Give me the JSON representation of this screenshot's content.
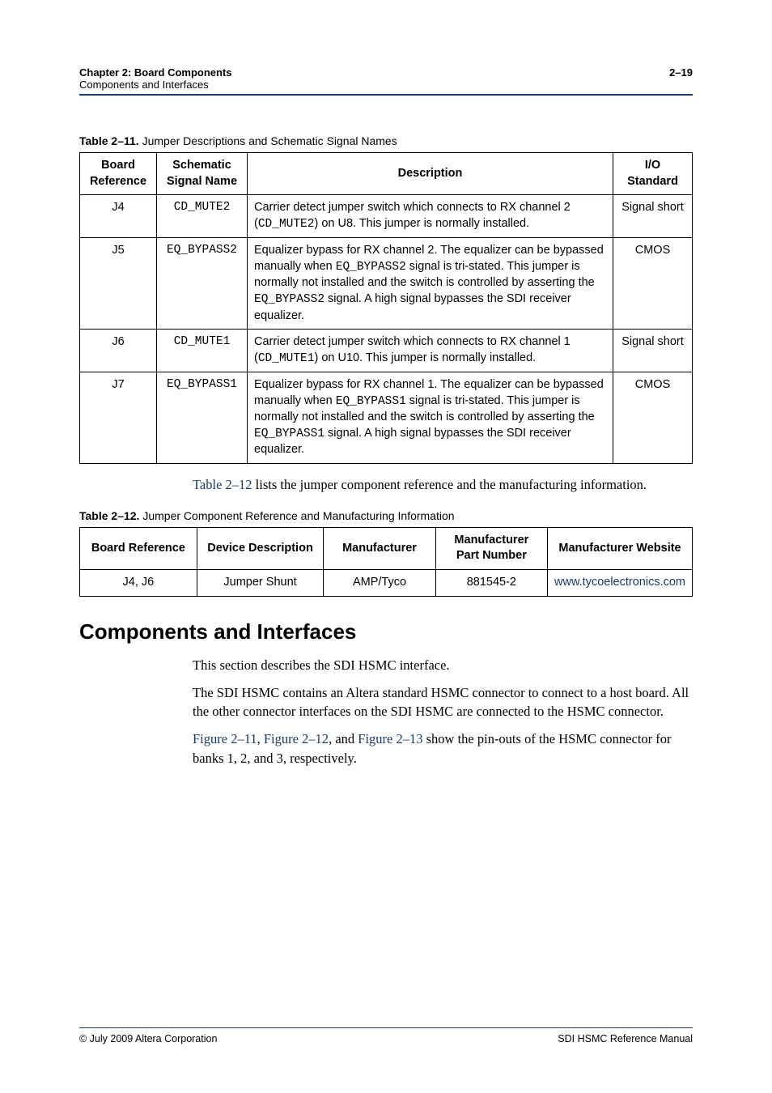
{
  "header": {
    "chapter": "Chapter 2: Board Components",
    "section": "Components and Interfaces",
    "page_num": "2–19"
  },
  "table1": {
    "num": "Table 2–11.",
    "title": "Jumper Descriptions and Schematic Signal Names",
    "headers": {
      "c1": "Board Reference",
      "c2": "Schematic Signal Name",
      "c3": "Description",
      "c4": "I/O Standard"
    },
    "rows": [
      {
        "ref": "J4",
        "signal": "CD_MUTE2",
        "desc_pre": "Carrier detect jumper switch which connects to RX channel 2 (",
        "desc_mono": "CD_MUTE2",
        "desc_post": ") on U8. This jumper is normally installed.",
        "io": "Signal short"
      },
      {
        "ref": "J5",
        "signal": "EQ_BYPASS2",
        "desc_pre": "Equalizer bypass for RX channel 2. The equalizer can be bypassed manually when ",
        "desc_mono": "EQ_BYPASS2",
        "desc_mid": " signal is tri-stated. This jumper is normally not installed and the switch is controlled by asserting the ",
        "desc_mono2": "EQ_BYPASS2",
        "desc_post2": " signal. A high signal bypasses the SDI receiver equalizer.",
        "io": "CMOS"
      },
      {
        "ref": "J6",
        "signal": "CD_MUTE1",
        "desc_pre": "Carrier detect jumper switch which connects to RX channel 1 (",
        "desc_mono": "CD_MUTE1",
        "desc_post": ") on U10. This jumper is normally installed.",
        "io": "Signal short"
      },
      {
        "ref": "J7",
        "signal": "EQ_BYPASS1",
        "desc_pre": "Equalizer bypass for RX channel 1. The equalizer can be bypassed manually when ",
        "desc_mono": "EQ_BYPASS1",
        "desc_mid": " signal is tri-stated. This jumper is normally not installed and the switch is controlled by asserting the ",
        "desc_mono2": "EQ_BYPASS1",
        "desc_post2": " signal. A high signal bypasses the SDI receiver equalizer.",
        "io": "CMOS"
      }
    ]
  },
  "para1": {
    "xref": "Table 2–12",
    "text": " lists the jumper component reference and the manufacturing information."
  },
  "table2": {
    "num": "Table 2–12.",
    "title": "Jumper Component Reference and Manufacturing Information",
    "headers": {
      "c1": "Board Reference",
      "c2": "Device Description",
      "c3": "Manufacturer",
      "c4": "Manufacturer Part Number",
      "c5": "Manufacturer Website"
    },
    "row": {
      "ref": "J4, J6",
      "desc": "Jumper Shunt",
      "mfr": "AMP/Tyco",
      "part": "881545-2",
      "url": "www.tycoelectronics.com"
    }
  },
  "section": {
    "heading": "Components and Interfaces",
    "p1": "This section describes the SDI HSMC interface.",
    "p2": "The SDI HSMC contains an Altera standard HSMC connector to connect to a host board. All the other connector interfaces on the SDI HSMC are connected to the HSMC connector.",
    "p3_x1": "Figure 2–11",
    "p3_s1": ", ",
    "p3_x2": "Figure 2–12",
    "p3_s2": ", and ",
    "p3_x3": "Figure 2–13",
    "p3_rest": " show the pin-outs of the HSMC connector for banks 1, 2, and 3, respectively."
  },
  "footer": {
    "left": "© July 2009   Altera Corporation",
    "right": "SDI HSMC Reference Manual"
  }
}
